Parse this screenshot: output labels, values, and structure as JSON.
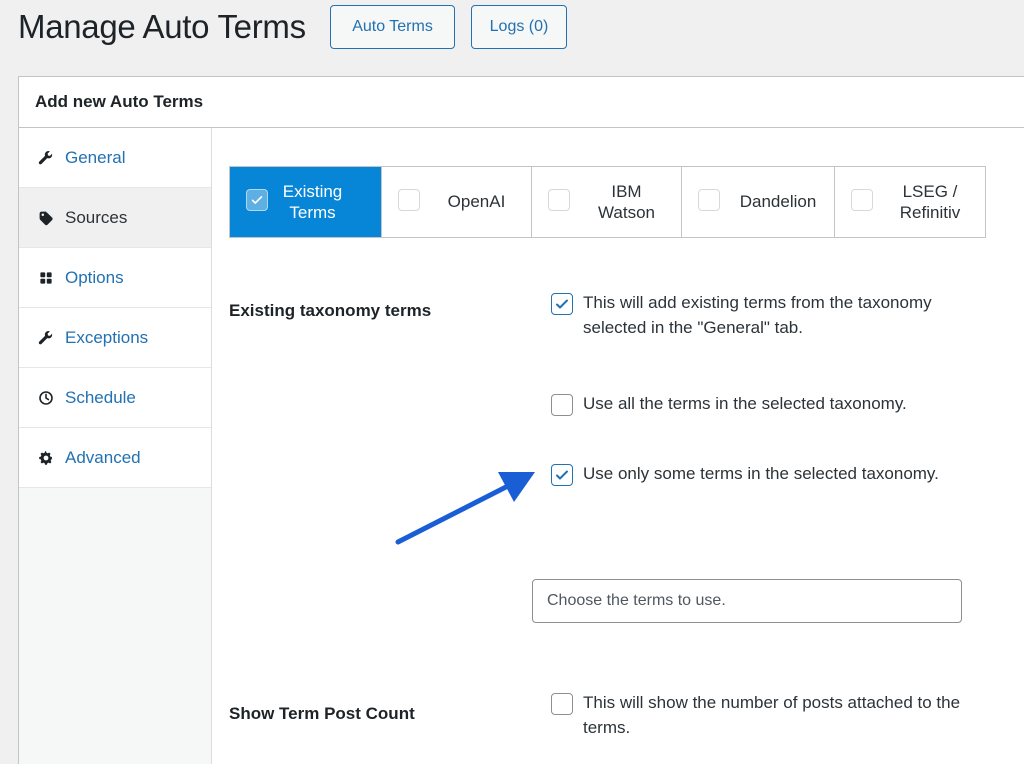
{
  "header": {
    "title": "Manage Auto Terms",
    "auto_terms_button": "Auto Terms",
    "logs_button": "Logs (0)"
  },
  "card": {
    "title": "Add new Auto Terms"
  },
  "sidebar": {
    "items": [
      {
        "label": "General",
        "icon": "wrench-icon",
        "active": false
      },
      {
        "label": "Sources",
        "icon": "tag-icon",
        "active": true
      },
      {
        "label": "Options",
        "icon": "grid-icon",
        "active": false
      },
      {
        "label": "Exceptions",
        "icon": "wrench-icon",
        "active": false
      },
      {
        "label": "Schedule",
        "icon": "clock-icon",
        "active": false
      },
      {
        "label": "Advanced",
        "icon": "gear-icon",
        "active": false
      }
    ]
  },
  "tabs": [
    {
      "label": "Existing\nTerms",
      "line1": "Existing",
      "line2": "Terms",
      "active": true
    },
    {
      "label": "OpenAI",
      "line1": "OpenAI",
      "line2": "",
      "active": false
    },
    {
      "label": "IBM\nWatson",
      "line1": "IBM",
      "line2": "Watson",
      "active": false
    },
    {
      "label": "Dandelion",
      "line1": "Dandelion",
      "line2": "",
      "active": false
    },
    {
      "label": "LSEG /\nRefinitiv",
      "line1": "LSEG /",
      "line2": "Refinitiv",
      "active": false
    }
  ],
  "existing_taxonomy": {
    "label": "Existing taxonomy terms",
    "enable_text": "This will add existing terms from the taxonomy selected in the \"General\" tab.",
    "enable_checked": true,
    "all_terms_text": "Use all the terms in the selected taxonomy.",
    "all_terms_checked": false,
    "some_terms_text": "Use only some terms in the selected taxonomy.",
    "some_terms_checked": true,
    "terms_placeholder": "Choose the terms to use."
  },
  "post_count": {
    "label": "Show Term Post Count",
    "text": "This will show the number of posts attached to the terms.",
    "checked": false
  },
  "colors": {
    "accent": "#2271b1",
    "active_tab": "#0785d6",
    "arrow": "#1a5ed6"
  }
}
